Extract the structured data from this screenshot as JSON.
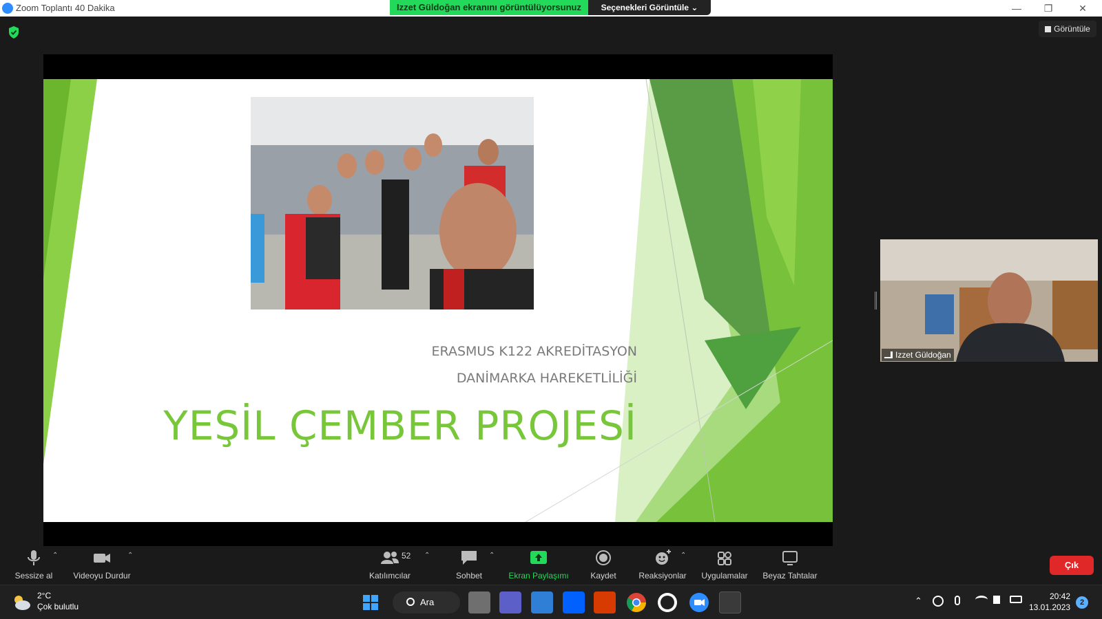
{
  "window": {
    "title": "Zoom Toplantı 40 Dakika",
    "share_banner": "Izzet Güldoğan ekranını görüntülüyorsunuz",
    "share_options": "Seçenekleri Görüntüle ⌄",
    "minimize": "—",
    "restore": "❐",
    "close": "✕"
  },
  "stage": {
    "view_button": "Görüntüle"
  },
  "slide": {
    "subtitle_1": "ERASMUS K122 AKREDİTASYON",
    "subtitle_2": "DANİMARKA HAREKETLİLİĞİ",
    "title": "YEŞİL ÇEMBER PROJESİ"
  },
  "participant": {
    "name": "Izzet Güldoğan"
  },
  "toolbar": {
    "mute": "Sessize al",
    "video": "Videoyu Durdur",
    "participants": "Katılımcılar",
    "participants_count": "52",
    "chat": "Sohbet",
    "share": "Ekran Paylaşımı",
    "record": "Kaydet",
    "reactions": "Reaksiyonlar",
    "apps": "Uygulamalar",
    "whiteboards": "Beyaz Tahtalar",
    "leave": "Çık",
    "caret": "⌃"
  },
  "taskbar": {
    "weather_temp": "2°C",
    "weather_desc": "Çok bulutlu",
    "search": "Ara",
    "time": "20:42",
    "date": "13.01.2023",
    "notifications": "2"
  },
  "colors": {
    "share_green": "#23d959",
    "slide_green": "#78c73a",
    "leave_red": "#e02828",
    "zoom_blue": "#2d8cff"
  }
}
